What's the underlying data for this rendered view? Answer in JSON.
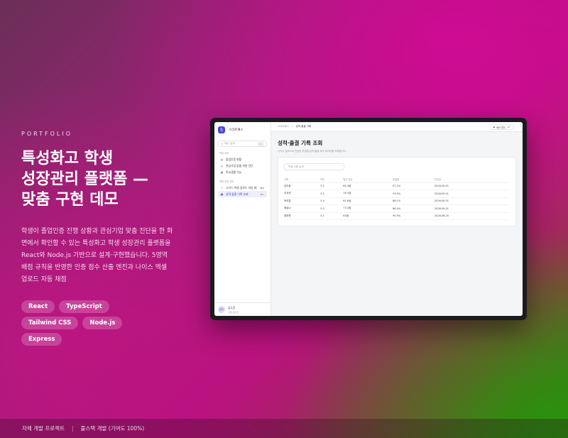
{
  "hero": {
    "eyebrow": "PORTFOLIO",
    "title_lines": [
      "특성화고 학생",
      "성장관리 플랫폼 —",
      "맞춤 구현 데모"
    ],
    "description": "학생이 졸업인증 진행 상황과 관심기업 맞춤 진단을 한 화면에서 확인할 수 있는 특성화고 학생 성장관리 플랫폼을 React와 Node.js 기반으로 설계·구현했습니다. 5영역 배점 규칙을 반영한 인증 점수 산출 엔진과 나이스 엑셀 업로드 자동 채점",
    "tags": [
      "React",
      "TypeScript",
      "Tailwind CSS",
      "Node.js",
      "Express"
    ]
  },
  "footer": {
    "left": "자체 개발 프로젝트",
    "separator": "|",
    "right": "풀스택 개발 (기여도 100%)"
  },
  "app": {
    "brand": {
      "logo_letter": "S",
      "name": "스타트패스"
    },
    "search": {
      "placeholder": "메뉴 검색",
      "icon": "search-icon",
      "shortcut": "⌘K"
    },
    "sections": [
      {
        "label": "학생 관리",
        "items": [
          {
            "label": "졸업인증 현황",
            "icon": "chart-icon",
            "badge": ""
          },
          {
            "label": "관심기업 맞춤 역량 진단",
            "icon": "target-icon",
            "badge": ""
          },
          {
            "label": "학교생활 기능",
            "icon": "calendar-icon",
            "badge": ""
          }
        ]
      },
      {
        "label": "학적·성적 관리",
        "items": [
          {
            "label": "나이스 엑셀 업로드 자동 채점",
            "icon": "upload-icon",
            "badge": "⌘4"
          },
          {
            "label": "성적·출결 기록 조회",
            "icon": "document-icon",
            "badge": "⌘5",
            "active": true
          }
        ]
      }
    ],
    "user": {
      "initials": "김도",
      "name": "김도윤",
      "role": "학생 관리자"
    },
    "breadcrumb": {
      "root": "스타트패스",
      "separator": "/",
      "current": "성적·출결 기록"
    },
    "top_button": {
      "label": "화면 캡처",
      "shortcut": "⌘P"
    },
    "page_title": "성적·출결 기록 조회",
    "page_subtitle": "나이스 업로드로 반영된 학생별 성적·출결 요약 데이터를 조회합니다.",
    "table_search_placeholder": "학생 이름 검색",
    "table": {
      "columns": [
        "이름",
        "학반",
        "평균 등급",
        "출결률",
        "반영일"
      ],
      "rows": [
        [
          "김도윤",
          "3-2",
          "84.4점",
          "97.2%",
          "2026.09.01"
        ],
        [
          "이서연",
          "3-1",
          "78.1점",
          "93.5%",
          "2026.09.01"
        ],
        [
          "박지훈",
          "3-4",
          "61.8점",
          "88.1%",
          "2026.09.01"
        ],
        [
          "최유나",
          "3-3",
          "73.4점",
          "86.4%",
          "2026.09.01"
        ],
        [
          "정하준",
          "3-1",
          "64점",
          "95.5%",
          "2026.08.25"
        ]
      ]
    }
  }
}
